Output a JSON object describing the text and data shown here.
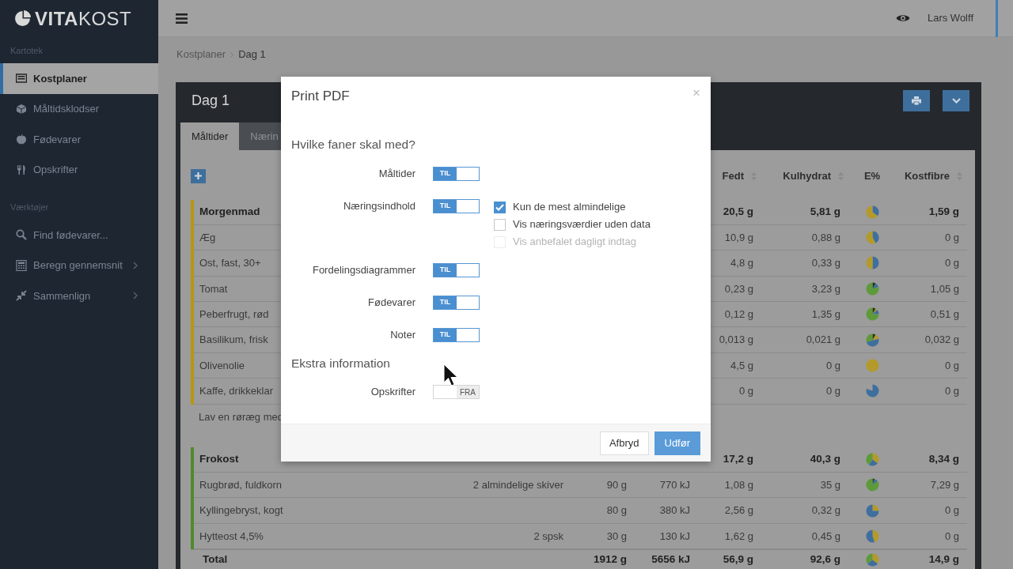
{
  "sidebar": {
    "logo": "**VITA**KOST",
    "sections": [
      {
        "label": "Kartotek",
        "items": [
          {
            "label": "Kostplaner",
            "selected": true,
            "submenu": false
          },
          {
            "label": "Måltidsklodser",
            "selected": false,
            "submenu": false
          },
          {
            "label": "Fødevarer",
            "selected": false,
            "submenu": false
          },
          {
            "label": "Opskrifter",
            "selected": false,
            "submenu": false
          }
        ]
      },
      {
        "label": "Værktøjer",
        "items": [
          {
            "label": "Find fødevarer...",
            "selected": false,
            "submenu": false
          },
          {
            "label": "Beregn gennemsnit",
            "selected": false,
            "submenu": true
          },
          {
            "label": "Sammenlign",
            "selected": false,
            "submenu": true
          }
        ]
      }
    ]
  },
  "topbar": {
    "user": "Lars Wolff"
  },
  "breadcrumb": [
    "Kostplaner",
    "Dag 1"
  ],
  "panel": {
    "title": "Dag 1",
    "tabs": [
      {
        "label": "Måltider",
        "selected": true
      },
      {
        "label": "Nærin",
        "selected": false
      }
    ],
    "table": {
      "columns": [
        {
          "label": "Fedt",
          "sortable": true
        },
        {
          "label": "Kulhydrat",
          "sortable": true
        },
        {
          "label": "E%",
          "sortable": false
        },
        {
          "label": "Kostfibre",
          "sortable": true
        }
      ],
      "groups": [
        {
          "name": "Morgenmad",
          "color": "#b8960f",
          "fat": "20,5 g",
          "carbs": "5,81 g",
          "fiber": "1,59 g",
          "note": "Lav en røræg med",
          "items": [
            {
              "name": "Æg",
              "fat": "10,9 g",
              "carbs": "0,88 g",
              "fiber": "0 g"
            },
            {
              "name": "Ost, fast, 30+",
              "fat": "4,8 g",
              "carbs": "0,33 g",
              "fiber": "0 g"
            },
            {
              "name": "Tomat",
              "fat": "0,23 g",
              "carbs": "3,23 g",
              "fiber": "1,05 g"
            },
            {
              "name": "Peberfrugt, rød",
              "fat": "0,12 g",
              "carbs": "1,35 g",
              "fiber": "0,51 g"
            },
            {
              "name": "Basilikum, frisk",
              "fat": "0,013 g",
              "carbs": "0,021 g",
              "fiber": "0,032 g"
            },
            {
              "name": "Olivenolie",
              "fat": "4,5 g",
              "carbs": "0 g",
              "fiber": "0 g"
            },
            {
              "name": "Kaffe, drikkeklar",
              "fat": "0 g",
              "carbs": "0 g",
              "fiber": "0 g"
            }
          ]
        },
        {
          "name": "Frokost",
          "color": "#4e8a2b",
          "fat": "17,2 g",
          "carbs": "40,3 g",
          "fiber": "8,34 g",
          "items": [
            {
              "name": "Rugbrød, fuldkorn",
              "portion": "2 almindelige skiver",
              "amount": "90 g",
              "energy": "770 kJ",
              "fat": "1,08 g",
              "carbs": "35 g",
              "fiber": "7,29 g"
            },
            {
              "name": "Kyllingebryst, kogt",
              "amount": "80 g",
              "energy": "380 kJ",
              "fat": "2,56 g",
              "carbs": "0,32 g",
              "fiber": "0 g"
            },
            {
              "name": "Hytteost 4,5%",
              "portion": "2 spsk",
              "amount": "30 g",
              "energy": "130 kJ",
              "fat": "1,62 g",
              "carbs": "0,45 g",
              "fiber": "0 g"
            }
          ]
        }
      ],
      "total": {
        "name": "Total",
        "amount": "1912 g",
        "energy": "5656 kJ",
        "fat": "56,9 g",
        "carbs": "92,6 g",
        "fiber": "14,9 g"
      }
    }
  },
  "modal": {
    "title": "Print PDF",
    "close": "×",
    "sections": [
      {
        "heading": "Hvilke faner skal med?",
        "toggles": [
          {
            "label": "Måltider",
            "on": true,
            "switch_text": "TIL"
          },
          {
            "label": "Næringsindhold",
            "on": true,
            "switch_text": "TIL",
            "options": [
              {
                "label": "Kun de mest almindelige",
                "checked": true,
                "disabled": false
              },
              {
                "label": "Vis næringsværdier uden data",
                "checked": false,
                "disabled": false
              },
              {
                "label": "Vis anbefalet dagligt indtag",
                "checked": false,
                "disabled": true
              }
            ]
          },
          {
            "label": "Fordelingsdiagrammer",
            "on": true,
            "switch_text": "TIL"
          },
          {
            "label": "Fødevarer",
            "on": true,
            "switch_text": "TIL"
          },
          {
            "label": "Noter",
            "on": true,
            "switch_text": "TIL"
          }
        ]
      },
      {
        "heading": "Ekstra information",
        "toggles": [
          {
            "label": "Opskrifter",
            "on": false,
            "switch_text": "FRA"
          }
        ]
      }
    ],
    "buttons": [
      {
        "label": "Afbryd",
        "kind": "secondary"
      },
      {
        "label": "Udfør",
        "kind": "primary"
      }
    ]
  }
}
